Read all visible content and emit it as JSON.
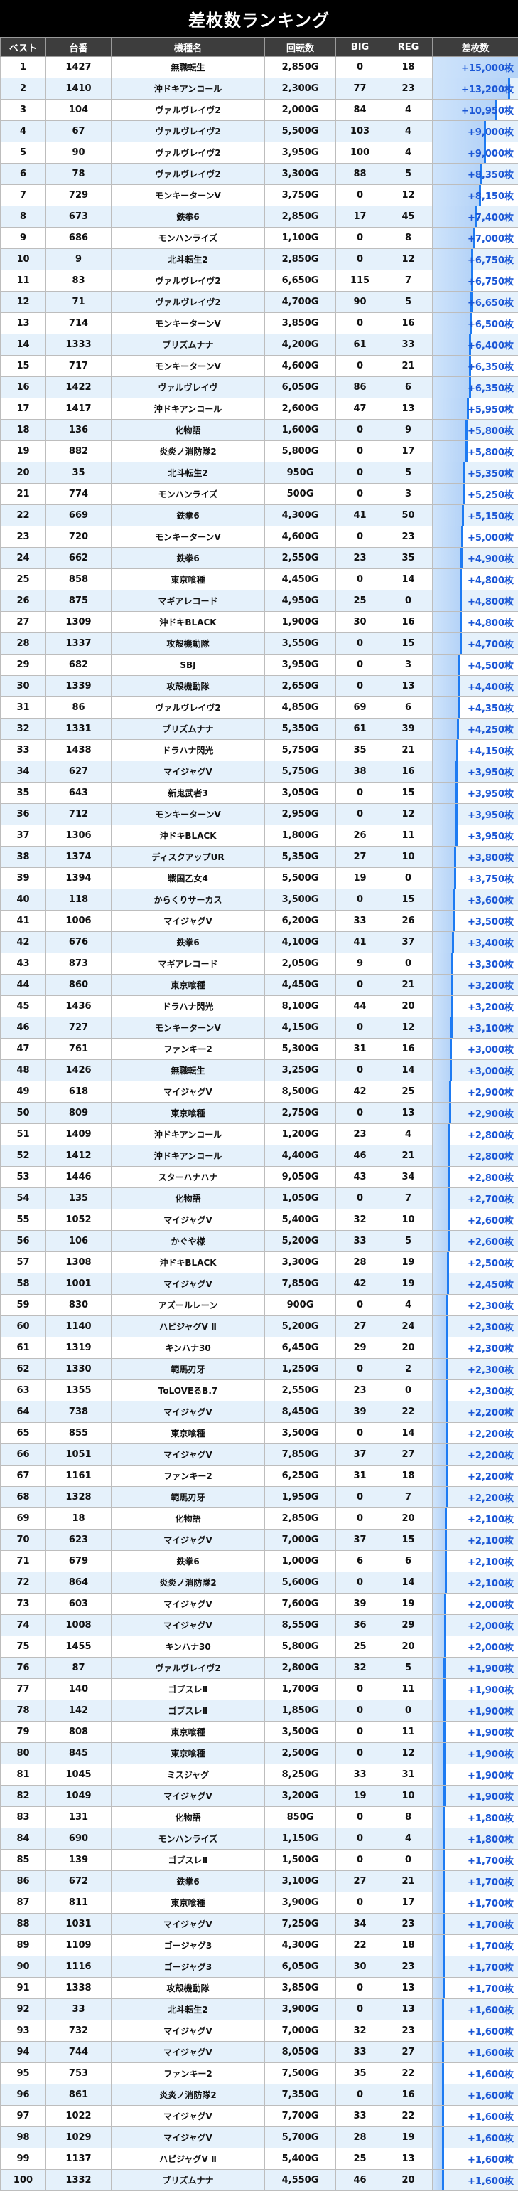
{
  "title": "差枚数ランキング",
  "headers": [
    "ベスト",
    "台番",
    "機種名",
    "回転数",
    "BIG",
    "REG",
    "差枚数"
  ],
  "max_diff": 15000,
  "rows": [
    [
      "1",
      "1427",
      "無職転生",
      "2,850G",
      "0",
      "18",
      "+15,000枚"
    ],
    [
      "2",
      "1410",
      "沖ドキアンコール",
      "2,300G",
      "77",
      "23",
      "+13,200枚"
    ],
    [
      "3",
      "104",
      "ヴァルヴレイヴ2",
      "2,000G",
      "84",
      "4",
      "+10,950枚"
    ],
    [
      "4",
      "67",
      "ヴァルヴレイヴ2",
      "5,500G",
      "103",
      "4",
      "+9,000枚"
    ],
    [
      "5",
      "90",
      "ヴァルヴレイヴ2",
      "3,950G",
      "100",
      "4",
      "+9,000枚"
    ],
    [
      "6",
      "78",
      "ヴァルヴレイヴ2",
      "3,300G",
      "88",
      "5",
      "+8,350枚"
    ],
    [
      "7",
      "729",
      "モンキーターンV",
      "3,750G",
      "0",
      "12",
      "+8,150枚"
    ],
    [
      "8",
      "673",
      "鉄拳6",
      "2,850G",
      "17",
      "45",
      "+7,400枚"
    ],
    [
      "9",
      "686",
      "モンハンライズ",
      "1,100G",
      "0",
      "8",
      "+7,000枚"
    ],
    [
      "10",
      "9",
      "北斗転生2",
      "2,850G",
      "0",
      "12",
      "+6,750枚"
    ],
    [
      "11",
      "83",
      "ヴァルヴレイヴ2",
      "6,650G",
      "115",
      "7",
      "+6,750枚"
    ],
    [
      "12",
      "71",
      "ヴァルヴレイヴ2",
      "4,700G",
      "90",
      "5",
      "+6,650枚"
    ],
    [
      "13",
      "714",
      "モンキーターンV",
      "3,850G",
      "0",
      "16",
      "+6,500枚"
    ],
    [
      "14",
      "1333",
      "ブリズムナナ",
      "4,200G",
      "61",
      "33",
      "+6,400枚"
    ],
    [
      "15",
      "717",
      "モンキーターンV",
      "4,600G",
      "0",
      "21",
      "+6,350枚"
    ],
    [
      "16",
      "1422",
      "ヴァルヴレイヴ",
      "6,050G",
      "86",
      "6",
      "+6,350枚"
    ],
    [
      "17",
      "1417",
      "沖ドキアンコール",
      "2,600G",
      "47",
      "13",
      "+5,950枚"
    ],
    [
      "18",
      "136",
      "化物語",
      "1,600G",
      "0",
      "9",
      "+5,800枚"
    ],
    [
      "19",
      "882",
      "炎炎ノ消防隊2",
      "5,800G",
      "0",
      "17",
      "+5,800枚"
    ],
    [
      "20",
      "35",
      "北斗転生2",
      "950G",
      "0",
      "5",
      "+5,350枚"
    ],
    [
      "21",
      "774",
      "モンハンライズ",
      "500G",
      "0",
      "3",
      "+5,250枚"
    ],
    [
      "22",
      "669",
      "鉄拳6",
      "4,300G",
      "41",
      "50",
      "+5,150枚"
    ],
    [
      "23",
      "720",
      "モンキーターンV",
      "4,600G",
      "0",
      "23",
      "+5,000枚"
    ],
    [
      "24",
      "662",
      "鉄拳6",
      "2,550G",
      "23",
      "35",
      "+4,900枚"
    ],
    [
      "25",
      "858",
      "東京喰種",
      "4,450G",
      "0",
      "14",
      "+4,800枚"
    ],
    [
      "26",
      "875",
      "マギアレコード",
      "4,950G",
      "25",
      "0",
      "+4,800枚"
    ],
    [
      "27",
      "1309",
      "沖ドキBLACK",
      "1,900G",
      "30",
      "16",
      "+4,800枚"
    ],
    [
      "28",
      "1337",
      "攻殻機動隊",
      "3,550G",
      "0",
      "15",
      "+4,700枚"
    ],
    [
      "29",
      "682",
      "SBJ",
      "3,950G",
      "0",
      "3",
      "+4,500枚"
    ],
    [
      "30",
      "1339",
      "攻殻機動隊",
      "2,650G",
      "0",
      "13",
      "+4,400枚"
    ],
    [
      "31",
      "86",
      "ヴァルヴレイヴ2",
      "4,850G",
      "69",
      "6",
      "+4,350枚"
    ],
    [
      "32",
      "1331",
      "ブリズムナナ",
      "5,350G",
      "61",
      "39",
      "+4,250枚"
    ],
    [
      "33",
      "1438",
      "ドラハナ閃光",
      "5,750G",
      "35",
      "21",
      "+4,150枚"
    ],
    [
      "34",
      "627",
      "マイジャグV",
      "5,750G",
      "38",
      "16",
      "+3,950枚"
    ],
    [
      "35",
      "643",
      "新鬼武者3",
      "3,050G",
      "0",
      "15",
      "+3,950枚"
    ],
    [
      "36",
      "712",
      "モンキーターンV",
      "2,950G",
      "0",
      "12",
      "+3,950枚"
    ],
    [
      "37",
      "1306",
      "沖ドキBLACK",
      "1,800G",
      "26",
      "11",
      "+3,950枚"
    ],
    [
      "38",
      "1374",
      "ディスクアップUR",
      "5,350G",
      "27",
      "10",
      "+3,800枚"
    ],
    [
      "39",
      "1394",
      "戦国乙女4",
      "5,500G",
      "19",
      "0",
      "+3,750枚"
    ],
    [
      "40",
      "118",
      "からくりサーカス",
      "3,500G",
      "0",
      "15",
      "+3,600枚"
    ],
    [
      "41",
      "1006",
      "マイジャグV",
      "6,200G",
      "33",
      "26",
      "+3,500枚"
    ],
    [
      "42",
      "676",
      "鉄拳6",
      "4,100G",
      "41",
      "37",
      "+3,400枚"
    ],
    [
      "43",
      "873",
      "マギアレコード",
      "2,050G",
      "9",
      "0",
      "+3,300枚"
    ],
    [
      "44",
      "860",
      "東京喰種",
      "4,450G",
      "0",
      "21",
      "+3,200枚"
    ],
    [
      "45",
      "1436",
      "ドラハナ閃光",
      "8,100G",
      "44",
      "20",
      "+3,200枚"
    ],
    [
      "46",
      "727",
      "モンキーターンV",
      "4,150G",
      "0",
      "12",
      "+3,100枚"
    ],
    [
      "47",
      "761",
      "ファンキー2",
      "5,300G",
      "31",
      "16",
      "+3,000枚"
    ],
    [
      "48",
      "1426",
      "無職転生",
      "3,250G",
      "0",
      "14",
      "+3,000枚"
    ],
    [
      "49",
      "618",
      "マイジャグV",
      "8,500G",
      "42",
      "25",
      "+2,900枚"
    ],
    [
      "50",
      "809",
      "東京喰種",
      "2,750G",
      "0",
      "13",
      "+2,900枚"
    ],
    [
      "51",
      "1409",
      "沖ドキアンコール",
      "1,200G",
      "23",
      "4",
      "+2,800枚"
    ],
    [
      "52",
      "1412",
      "沖ドキアンコール",
      "4,400G",
      "46",
      "21",
      "+2,800枚"
    ],
    [
      "53",
      "1446",
      "スターハナハナ",
      "9,050G",
      "43",
      "34",
      "+2,800枚"
    ],
    [
      "54",
      "135",
      "化物語",
      "1,050G",
      "0",
      "7",
      "+2,700枚"
    ],
    [
      "55",
      "1052",
      "マイジャグV",
      "5,400G",
      "32",
      "10",
      "+2,600枚"
    ],
    [
      "56",
      "106",
      "かぐや様",
      "5,200G",
      "33",
      "5",
      "+2,600枚"
    ],
    [
      "57",
      "1308",
      "沖ドキBLACK",
      "3,300G",
      "28",
      "19",
      "+2,500枚"
    ],
    [
      "58",
      "1001",
      "マイジャグV",
      "7,850G",
      "42",
      "19",
      "+2,450枚"
    ],
    [
      "59",
      "830",
      "アズールレーン",
      "900G",
      "0",
      "4",
      "+2,300枚"
    ],
    [
      "60",
      "1140",
      "ハピジャグV Ⅱ",
      "5,200G",
      "27",
      "24",
      "+2,300枚"
    ],
    [
      "61",
      "1319",
      "キンハナ30",
      "6,450G",
      "29",
      "20",
      "+2,300枚"
    ],
    [
      "62",
      "1330",
      "範馬刃牙",
      "1,250G",
      "0",
      "2",
      "+2,300枚"
    ],
    [
      "63",
      "1355",
      "ToLOVEるB.7",
      "2,550G",
      "23",
      "0",
      "+2,300枚"
    ],
    [
      "64",
      "738",
      "マイジャグV",
      "8,450G",
      "39",
      "22",
      "+2,200枚"
    ],
    [
      "65",
      "855",
      "東京喰種",
      "3,500G",
      "0",
      "14",
      "+2,200枚"
    ],
    [
      "66",
      "1051",
      "マイジャグV",
      "7,850G",
      "37",
      "27",
      "+2,200枚"
    ],
    [
      "67",
      "1161",
      "ファンキー2",
      "6,250G",
      "31",
      "18",
      "+2,200枚"
    ],
    [
      "68",
      "1328",
      "範馬刃牙",
      "1,950G",
      "0",
      "7",
      "+2,200枚"
    ],
    [
      "69",
      "18",
      "化物語",
      "2,850G",
      "0",
      "20",
      "+2,100枚"
    ],
    [
      "70",
      "623",
      "マイジャグV",
      "7,000G",
      "37",
      "15",
      "+2,100枚"
    ],
    [
      "71",
      "679",
      "鉄拳6",
      "1,000G",
      "6",
      "6",
      "+2,100枚"
    ],
    [
      "72",
      "864",
      "炎炎ノ消防隊2",
      "5,600G",
      "0",
      "14",
      "+2,100枚"
    ],
    [
      "73",
      "603",
      "マイジャグV",
      "7,600G",
      "39",
      "19",
      "+2,000枚"
    ],
    [
      "74",
      "1008",
      "マイジャグV",
      "8,550G",
      "36",
      "29",
      "+2,000枚"
    ],
    [
      "75",
      "1455",
      "キンハナ30",
      "5,800G",
      "25",
      "20",
      "+2,000枚"
    ],
    [
      "76",
      "87",
      "ヴァルヴレイヴ2",
      "2,800G",
      "32",
      "5",
      "+1,900枚"
    ],
    [
      "77",
      "140",
      "ゴブスレⅡ",
      "1,700G",
      "0",
      "11",
      "+1,900枚"
    ],
    [
      "78",
      "142",
      "ゴブスレⅡ",
      "1,850G",
      "0",
      "0",
      "+1,900枚"
    ],
    [
      "79",
      "808",
      "東京喰種",
      "3,500G",
      "0",
      "11",
      "+1,900枚"
    ],
    [
      "80",
      "845",
      "東京喰種",
      "2,500G",
      "0",
      "12",
      "+1,900枚"
    ],
    [
      "81",
      "1045",
      "ミスジャグ",
      "8,250G",
      "33",
      "31",
      "+1,900枚"
    ],
    [
      "82",
      "1049",
      "マイジャグV",
      "3,200G",
      "19",
      "10",
      "+1,900枚"
    ],
    [
      "83",
      "131",
      "化物語",
      "850G",
      "0",
      "8",
      "+1,800枚"
    ],
    [
      "84",
      "690",
      "モンハンライズ",
      "1,150G",
      "0",
      "4",
      "+1,800枚"
    ],
    [
      "85",
      "139",
      "ゴブスレⅡ",
      "1,500G",
      "0",
      "0",
      "+1,700枚"
    ],
    [
      "86",
      "672",
      "鉄拳6",
      "3,100G",
      "27",
      "21",
      "+1,700枚"
    ],
    [
      "87",
      "811",
      "東京喰種",
      "3,900G",
      "0",
      "17",
      "+1,700枚"
    ],
    [
      "88",
      "1031",
      "マイジャグV",
      "7,250G",
      "34",
      "23",
      "+1,700枚"
    ],
    [
      "89",
      "1109",
      "ゴージャグ3",
      "4,300G",
      "22",
      "18",
      "+1,700枚"
    ],
    [
      "90",
      "1116",
      "ゴージャグ3",
      "6,050G",
      "30",
      "23",
      "+1,700枚"
    ],
    [
      "91",
      "1338",
      "攻殻機動隊",
      "3,850G",
      "0",
      "13",
      "+1,700枚"
    ],
    [
      "92",
      "33",
      "北斗転生2",
      "3,900G",
      "0",
      "13",
      "+1,600枚"
    ],
    [
      "93",
      "732",
      "マイジャグV",
      "7,000G",
      "32",
      "23",
      "+1,600枚"
    ],
    [
      "94",
      "744",
      "マイジャグV",
      "8,050G",
      "33",
      "27",
      "+1,600枚"
    ],
    [
      "95",
      "753",
      "ファンキー2",
      "7,500G",
      "35",
      "22",
      "+1,600枚"
    ],
    [
      "96",
      "861",
      "炎炎ノ消防隊2",
      "7,350G",
      "0",
      "16",
      "+1,600枚"
    ],
    [
      "97",
      "1022",
      "マイジャグV",
      "7,700G",
      "33",
      "22",
      "+1,600枚"
    ],
    [
      "98",
      "1029",
      "マイジャグV",
      "5,700G",
      "28",
      "19",
      "+1,600枚"
    ],
    [
      "99",
      "1137",
      "ハピジャグV Ⅱ",
      "5,400G",
      "25",
      "13",
      "+1,600枚"
    ],
    [
      "100",
      "1332",
      "ブリズムナナ",
      "4,550G",
      "46",
      "20",
      "+1,600枚"
    ]
  ]
}
